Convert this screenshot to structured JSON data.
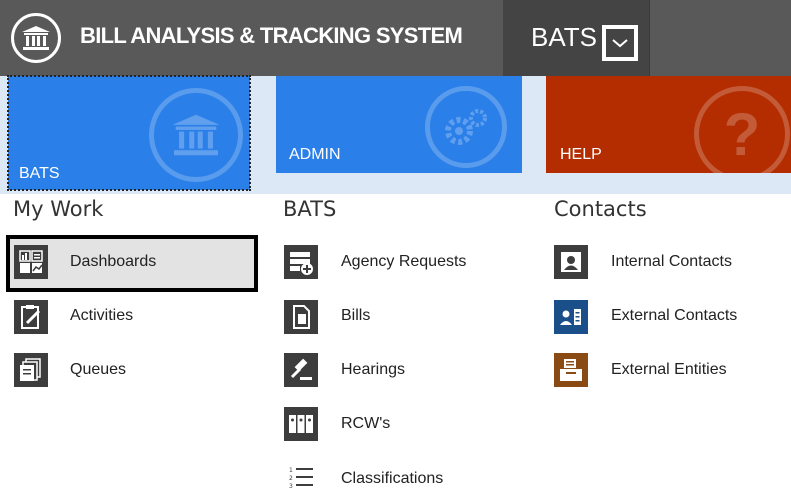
{
  "header": {
    "title": "BILL ANALYSIS & TRACKING SYSTEM",
    "module": "BATS",
    "logo_icon": "capitol-building-icon",
    "dropdown_icon": "chevron-down-icon"
  },
  "tiles": [
    {
      "label": "BATS",
      "icon": "capitol-building-icon",
      "color": "#2b7fe8"
    },
    {
      "label": "ADMIN",
      "icon": "gears-icon",
      "color": "#2b7fe8"
    },
    {
      "label": "HELP",
      "icon": "question-icon",
      "color": "#b32d00"
    }
  ],
  "my_work": {
    "heading": "My Work",
    "items": [
      {
        "label": "Dashboards",
        "icon": "dashboard-icon"
      },
      {
        "label": "Activities",
        "icon": "clipboard-edit-icon"
      },
      {
        "label": "Queues",
        "icon": "stacked-documents-icon"
      }
    ]
  },
  "bats": {
    "heading": "BATS",
    "items": [
      {
        "label": "Agency Requests",
        "icon": "add-request-icon"
      },
      {
        "label": "Bills",
        "icon": "document-icon"
      },
      {
        "label": "Hearings",
        "icon": "gavel-icon"
      },
      {
        "label": "RCW's",
        "icon": "binders-icon"
      },
      {
        "label": "Classifications",
        "icon": "numbered-list-icon"
      }
    ]
  },
  "contacts": {
    "heading": "Contacts",
    "items": [
      {
        "label": "Internal Contacts",
        "icon": "contact-card-icon",
        "color": "#3d3d3d"
      },
      {
        "label": "External Contacts",
        "icon": "address-book-icon",
        "color": "#1a4f8a"
      },
      {
        "label": "External Entities",
        "icon": "building-folder-icon",
        "color": "#8a4a14"
      }
    ]
  }
}
